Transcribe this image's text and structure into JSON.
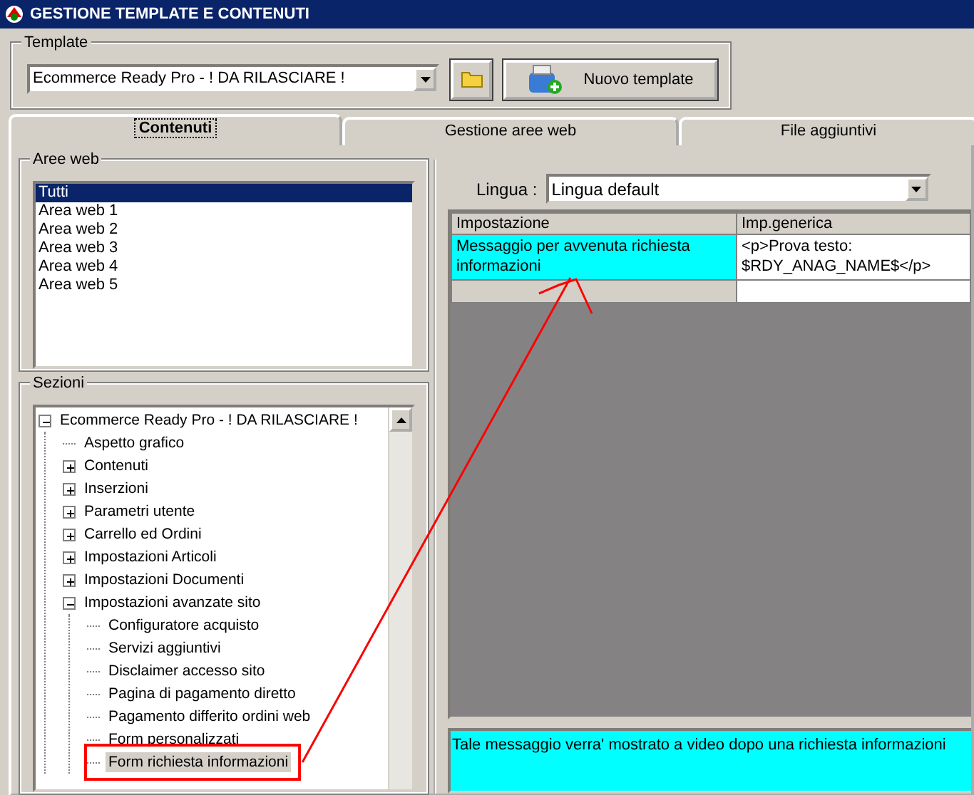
{
  "window": {
    "title": "GESTIONE TEMPLATE E CONTENUTI"
  },
  "template": {
    "label": "Template",
    "value": "Ecommerce Ready Pro - ! DA RILASCIARE !",
    "new_button": "Nuovo template"
  },
  "tabs": [
    {
      "label": "Contenuti",
      "selected": true
    },
    {
      "label": "Gestione aree web",
      "selected": false
    },
    {
      "label": "File aggiuntivi",
      "selected": false
    }
  ],
  "aree_web": {
    "label": "Aree web",
    "items": [
      {
        "label": "Tutti",
        "selected": true
      },
      {
        "label": "Area web 1",
        "selected": false
      },
      {
        "label": "Area web 2",
        "selected": false
      },
      {
        "label": "Area web 3",
        "selected": false
      },
      {
        "label": "Area web 4",
        "selected": false
      },
      {
        "label": "Area web 5",
        "selected": false
      }
    ]
  },
  "sezioni": {
    "label": "Sezioni",
    "tree": [
      {
        "label": "Ecommerce Ready Pro - ! DA RILASCIARE !",
        "expanded": true,
        "selected": false,
        "children": [
          {
            "label": "Aspetto grafico",
            "selected": false
          },
          {
            "label": "Contenuti",
            "expanded": false,
            "selected": false
          },
          {
            "label": "Inserzioni",
            "expanded": false,
            "selected": false
          },
          {
            "label": "Parametri utente",
            "expanded": false,
            "selected": false
          },
          {
            "label": "Carrello ed Ordini",
            "expanded": false,
            "selected": false
          },
          {
            "label": "Impostazioni Articoli",
            "expanded": false,
            "selected": false
          },
          {
            "label": "Impostazioni Documenti",
            "expanded": false,
            "selected": false
          },
          {
            "label": "Impostazioni avanzate sito",
            "expanded": true,
            "selected": false,
            "children": [
              {
                "label": "Configuratore acquisto",
                "selected": false
              },
              {
                "label": "Servizi aggiuntivi",
                "selected": false
              },
              {
                "label": "Disclaimer accesso sito",
                "selected": false
              },
              {
                "label": "Pagina di pagamento diretto",
                "selected": false
              },
              {
                "label": "Pagamento differito ordini web",
                "selected": false
              },
              {
                "label": "Form personalizzati",
                "selected": false
              },
              {
                "label": "Form richiesta informazioni",
                "selected": true
              }
            ]
          }
        ]
      }
    ]
  },
  "lingua": {
    "label": "Lingua :",
    "value": "Lingua default"
  },
  "table": {
    "columns": [
      "Impostazione",
      "Imp.generica"
    ],
    "rows": [
      {
        "cells": [
          "Messaggio per avvenuta richiesta informazioni",
          "<p>Prova testo: $RDY_ANAG_NAME$</p>"
        ],
        "selected": true
      }
    ]
  },
  "description": "Tale messaggio verra' mostrato a video dopo una richiesta informazioni"
}
